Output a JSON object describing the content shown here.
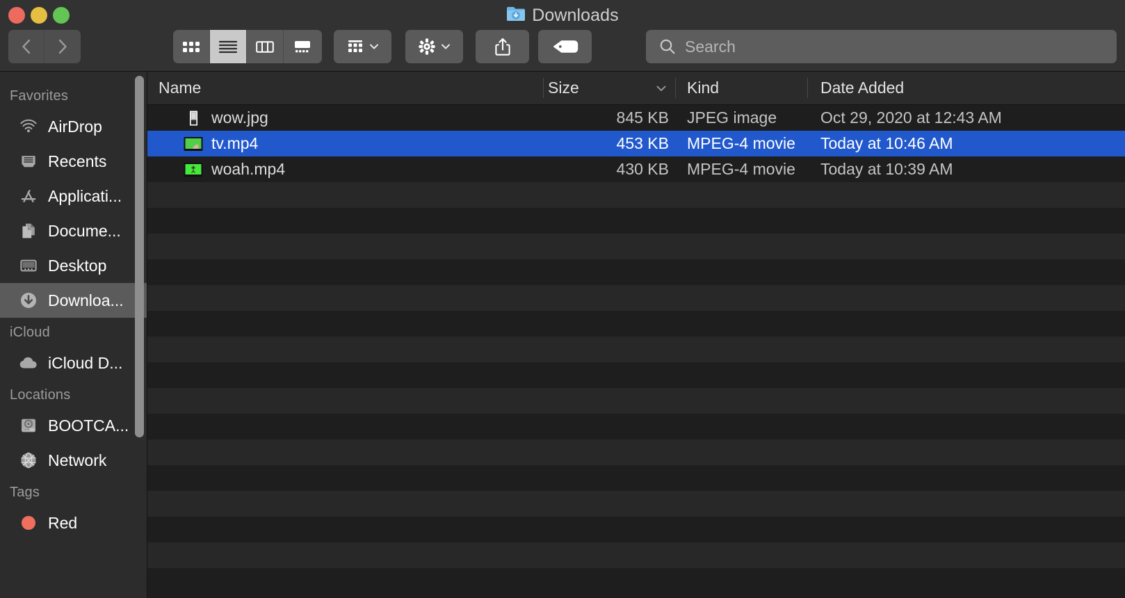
{
  "window": {
    "title": "Downloads",
    "title_icon": "downloads-folder-icon",
    "traffic_lights": [
      {
        "name": "close",
        "color": "#ed6a5e"
      },
      {
        "name": "minimize",
        "color": "#e4bf41"
      },
      {
        "name": "maximize",
        "color": "#62c554"
      }
    ]
  },
  "toolbar": {
    "back": {
      "icon": "chevron-left-icon",
      "enabled": false
    },
    "forward": {
      "icon": "chevron-right-icon",
      "enabled": false
    },
    "view_modes": [
      {
        "name": "icon-view",
        "icon": "grid-icon",
        "active": false
      },
      {
        "name": "list-view",
        "icon": "list-icon",
        "active": true
      },
      {
        "name": "column-view",
        "icon": "columns-icon",
        "active": false
      },
      {
        "name": "gallery-view",
        "icon": "gallery-icon",
        "active": false
      }
    ],
    "group_by": {
      "icon": "group-icon",
      "chevron": "chevron-down-icon"
    },
    "action": {
      "icon": "gear-icon",
      "chevron": "chevron-down-icon"
    },
    "share": {
      "icon": "share-icon"
    },
    "tags": {
      "icon": "tag-icon"
    }
  },
  "search": {
    "icon": "search-icon",
    "placeholder": "Search",
    "value": ""
  },
  "sidebar": {
    "sections": [
      {
        "heading": "Favorites",
        "items": [
          {
            "label": "AirDrop",
            "icon": "airdrop-icon",
            "selected": false
          },
          {
            "label": "Recents",
            "icon": "recents-icon",
            "selected": false
          },
          {
            "label": "Applicati...",
            "icon": "applications-icon",
            "selected": false
          },
          {
            "label": "Docume...",
            "icon": "documents-icon",
            "selected": false
          },
          {
            "label": "Desktop",
            "icon": "desktop-icon",
            "selected": false
          },
          {
            "label": "Downloa...",
            "icon": "downloads-icon",
            "selected": true
          }
        ]
      },
      {
        "heading": "iCloud",
        "items": [
          {
            "label": "iCloud D...",
            "icon": "cloud-icon",
            "selected": false
          }
        ]
      },
      {
        "heading": "Locations",
        "items": [
          {
            "label": "BOOTCA...",
            "icon": "harddisk-icon",
            "selected": false
          },
          {
            "label": "Network",
            "icon": "network-globe-icon",
            "selected": false
          }
        ]
      },
      {
        "heading": "Tags",
        "items": [
          {
            "label": "Red",
            "icon": "red-tag-dot-icon",
            "color": "#ef6e5e",
            "selected": false
          }
        ]
      }
    ]
  },
  "file_list": {
    "columns": [
      {
        "label": "Name",
        "sorted": false
      },
      {
        "label": "Size",
        "sorted": true,
        "sort_icon": "chevron-down-icon"
      },
      {
        "label": "Kind",
        "sorted": false
      },
      {
        "label": "Date Added",
        "sorted": false
      }
    ],
    "rows": [
      {
        "name": "wow.jpg",
        "size": "845 KB",
        "kind": "JPEG image",
        "date_added": "Oct 29, 2020 at 12:43 AM",
        "thumbnail": "photo-thumbnail",
        "selected": false
      },
      {
        "name": "tv.mp4",
        "size": "453 KB",
        "kind": "MPEG-4 movie",
        "date_added": "Today at 10:46 AM",
        "thumbnail": "video-green-screen-thumbnail",
        "selected": true
      },
      {
        "name": "woah.mp4",
        "size": "430 KB",
        "kind": "MPEG-4 movie",
        "date_added": "Today at 10:39 AM",
        "thumbnail": "video-green-thumbnail",
        "selected": false
      }
    ],
    "empty_row_count": 16
  },
  "colors": {
    "selection_blue": "#2159cd",
    "window_chrome": "#323232",
    "sidebar_bg": "#2c2c2c",
    "list_bg": "#1e1e1e",
    "list_stripe": "#282828"
  }
}
